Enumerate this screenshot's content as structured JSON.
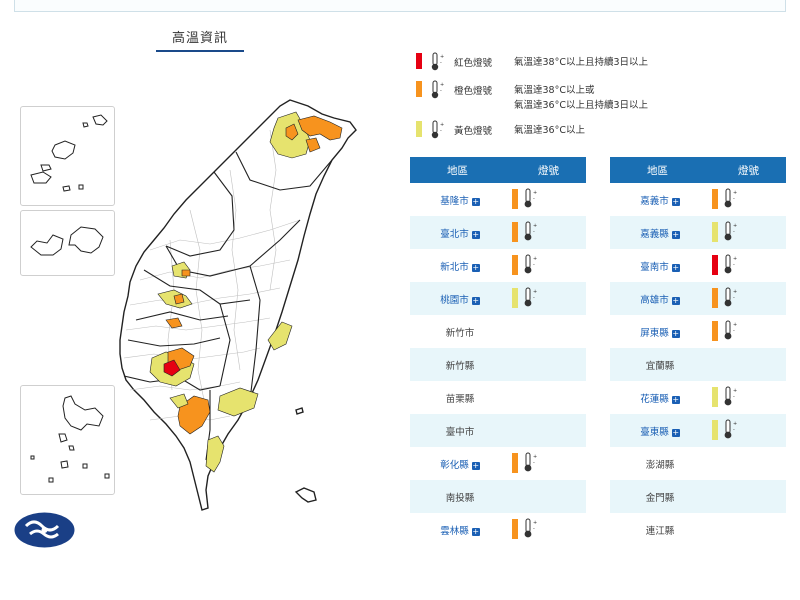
{
  "page": {
    "title": "高溫資訊"
  },
  "colors": {
    "red": "#e60012",
    "orange": "#f7931e",
    "yellow": "#e6e36e",
    "header": "#1a6fb3",
    "row_alt": "#e8f6fa",
    "link": "#1a5fb4"
  },
  "legend": [
    {
      "level": "red",
      "label": "紅色燈號",
      "desc": [
        "氣溫達38°C以上且持續3日以上"
      ]
    },
    {
      "level": "orange",
      "label": "橙色燈號",
      "desc": [
        "氣溫達38°C以上或",
        "氣溫達36°C以上且持續3日以上"
      ]
    },
    {
      "level": "yellow",
      "label": "黃色燈號",
      "desc": [
        "氣溫達36°C以上"
      ]
    }
  ],
  "table_headers": {
    "region": "地區",
    "signal": "燈號"
  },
  "tables": [
    {
      "rows": [
        {
          "region": "基隆市",
          "signal": "orange"
        },
        {
          "region": "臺北市",
          "signal": "orange"
        },
        {
          "region": "新北市",
          "signal": "orange"
        },
        {
          "region": "桃園市",
          "signal": "yellow"
        },
        {
          "region": "新竹市",
          "signal": ""
        },
        {
          "region": "新竹縣",
          "signal": ""
        },
        {
          "region": "苗栗縣",
          "signal": ""
        },
        {
          "region": "臺中市",
          "signal": ""
        },
        {
          "region": "彰化縣",
          "signal": "orange"
        },
        {
          "region": "南投縣",
          "signal": ""
        },
        {
          "region": "雲林縣",
          "signal": "orange"
        }
      ]
    },
    {
      "rows": [
        {
          "region": "嘉義市",
          "signal": "orange"
        },
        {
          "region": "嘉義縣",
          "signal": "yellow"
        },
        {
          "region": "臺南市",
          "signal": "red"
        },
        {
          "region": "高雄市",
          "signal": "orange"
        },
        {
          "region": "屏東縣",
          "signal": "orange"
        },
        {
          "region": "宜蘭縣",
          "signal": ""
        },
        {
          "region": "花蓮縣",
          "signal": "yellow"
        },
        {
          "region": "臺東縣",
          "signal": "yellow"
        },
        {
          "region": "澎湖縣",
          "signal": ""
        },
        {
          "region": "金門縣",
          "signal": ""
        },
        {
          "region": "連江縣",
          "signal": ""
        }
      ]
    }
  ]
}
